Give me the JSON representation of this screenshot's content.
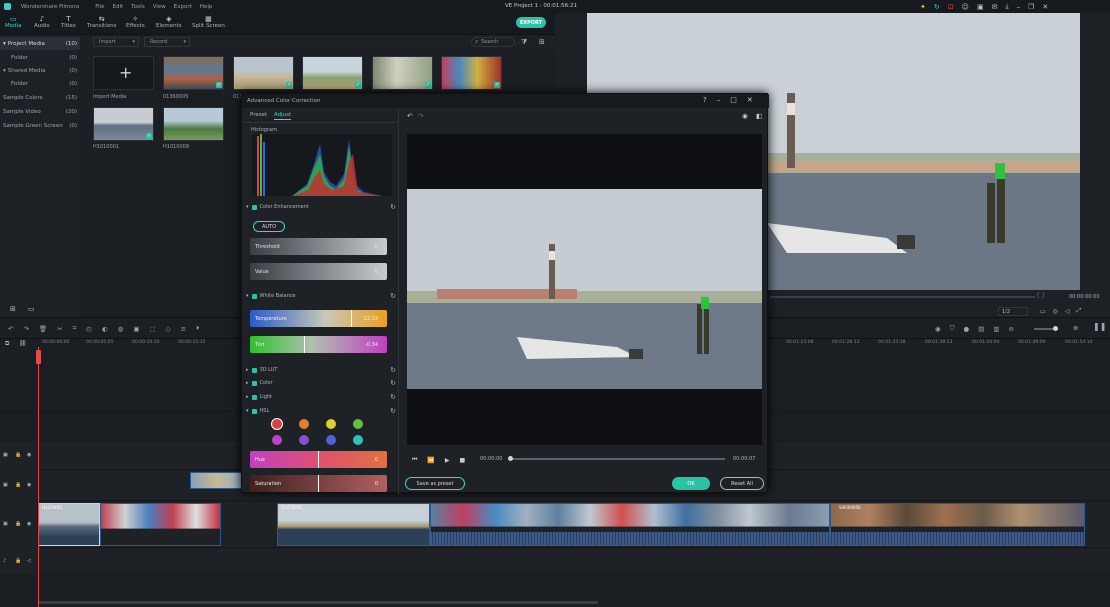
{
  "app": {
    "name": "Wondershare Filmora",
    "menus": [
      "File",
      "Edit",
      "Tools",
      "View",
      "Export",
      "Help"
    ],
    "project_title": "VE Project 1 : 00:01:56:21",
    "export_label": "EXPORT"
  },
  "toolbar_tabs": [
    {
      "label": "Media",
      "icon": "folder-icon"
    },
    {
      "label": "Audio",
      "icon": "music-icon"
    },
    {
      "label": "Titles",
      "icon": "text-icon"
    },
    {
      "label": "Transitions",
      "icon": "transition-icon"
    },
    {
      "label": "Effects",
      "icon": "effects-icon"
    },
    {
      "label": "Elements",
      "icon": "elements-icon"
    },
    {
      "label": "Split Screen",
      "icon": "split-screen-icon"
    }
  ],
  "library": [
    {
      "label": "Project Media",
      "count": "(10)"
    },
    {
      "label": "Folder",
      "count": "(0)"
    },
    {
      "label": "Shared Media",
      "count": "(0)"
    },
    {
      "label": "Folder",
      "count": "(0)"
    },
    {
      "label": "Sample Colors",
      "count": "(15)"
    },
    {
      "label": "Sample Video",
      "count": "(20)"
    },
    {
      "label": "Sample Green Screen",
      "count": "(0)"
    }
  ],
  "media_bar": {
    "import": "Import",
    "record": "Record",
    "search_placeholder": "Search"
  },
  "media_items": [
    {
      "label": "Import Media"
    },
    {
      "label": "01360005"
    },
    {
      "label": "013"
    },
    {
      "label": "H1010001"
    },
    {
      "label": "H1010009"
    }
  ],
  "dialog": {
    "title": "Advanced Color Correction",
    "tabs": [
      "Preset",
      "Adjust"
    ],
    "histogram_label": "Histogram",
    "sections": {
      "color_enhancement": "Color Enhancement",
      "white_balance": "White Balance",
      "lut": "3D LUT",
      "color": "Color",
      "light": "Light",
      "hsl": "HSL"
    },
    "auto": "AUTO",
    "threshold": {
      "label": "Threshold",
      "value": "0"
    },
    "value": {
      "label": "Value",
      "value": "0"
    },
    "temperature": {
      "label": "Temperature",
      "value": "12.13"
    },
    "tint": {
      "label": "Tint",
      "value": "-0.34"
    },
    "hue": {
      "label": "Hue",
      "value": "0"
    },
    "saturation": {
      "label": "Saturation",
      "value": "0"
    },
    "hsl_colors": [
      "#d94040",
      "#e08030",
      "#d8d030",
      "#60c040",
      "#c040c8",
      "#8050d0",
      "#5060d8",
      "#30c0c0"
    ],
    "time_current": "00:00:00",
    "time_total": "00:00:07",
    "save_preset": "Save as preset",
    "ok": "OK",
    "reset_all": "Reset All"
  },
  "preview": {
    "timecode": "00:00:00:00",
    "quality": "1/2"
  },
  "ruler": [
    "00:00:00:00",
    "00:00:05:05",
    "00:00:10:10",
    "00:00:15:15",
    "00:01:23:08",
    "00:01:28:13",
    "00:01:33:18",
    "00:01:38:23",
    "00:01:44:04",
    "00:01:49:09",
    "00:01:54:14"
  ],
  "clips": [
    "H1010001",
    "G1270035",
    "SI0000000"
  ]
}
